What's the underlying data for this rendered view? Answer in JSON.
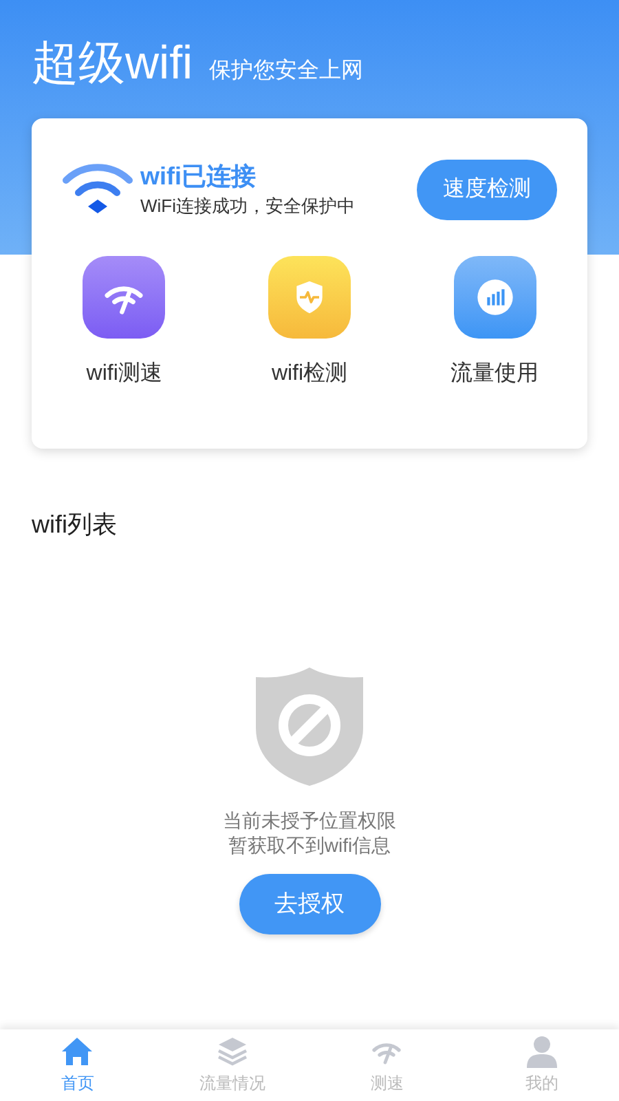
{
  "header": {
    "title": "超级wifi",
    "subtitle": "保护您安全上网"
  },
  "status_card": {
    "title": "wifi已连接",
    "subtitle": "WiFi连接成功，安全保护中",
    "button": "速度检测"
  },
  "tools": [
    {
      "kind": "speed",
      "label": "wifi测速"
    },
    {
      "kind": "check",
      "label": "wifi检测"
    },
    {
      "kind": "usage",
      "label": "流量使用"
    }
  ],
  "wifi_list": {
    "title": "wifi列表",
    "empty_message": [
      "当前未授予位置权限",
      "暂获取不到wifi信息"
    ],
    "button": "去授权"
  },
  "tab_bar": [
    {
      "kind": "home",
      "label": "首页",
      "selected": true
    },
    {
      "kind": "layers",
      "label": "流量情况",
      "selected": false
    },
    {
      "kind": "speed",
      "label": "测速",
      "selected": false
    },
    {
      "kind": "user",
      "label": "我的",
      "selected": false
    }
  ]
}
